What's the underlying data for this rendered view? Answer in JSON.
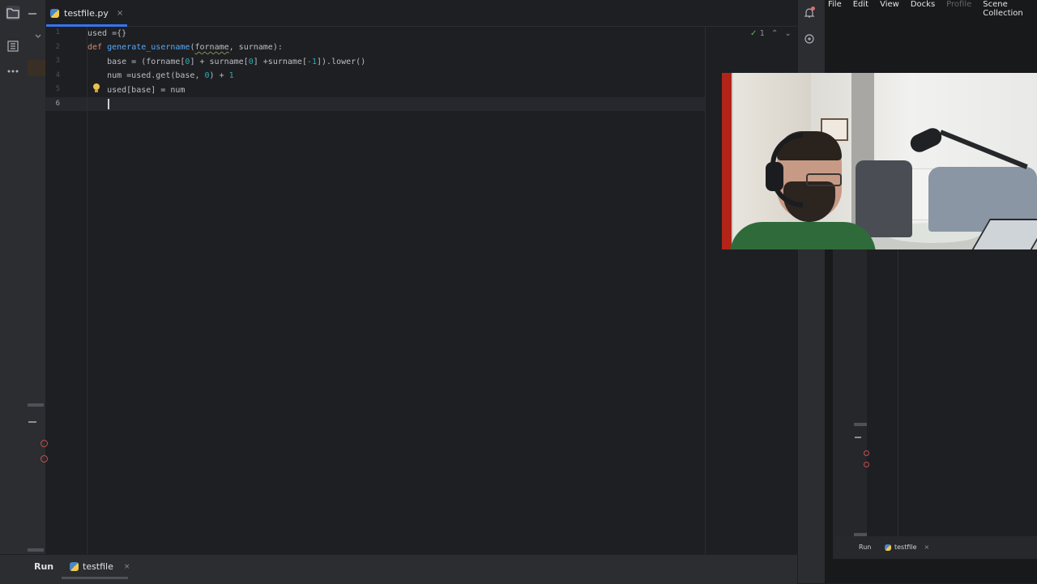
{
  "editor": {
    "tab": {
      "filename": "testfile.py",
      "close": "×"
    },
    "inspection": {
      "check": "✓",
      "count": "1",
      "up": "⌃",
      "down": "⌄"
    },
    "line_numbers": [
      "1",
      "2",
      "3",
      "4",
      "5",
      "6"
    ],
    "code": {
      "l1": {
        "text": "used ={}"
      },
      "l2": {
        "kw": "def",
        "fn": "generate_username",
        "open": "(",
        "param1": "forname",
        "rest": ", surname):"
      },
      "l3": {
        "a": "    base = (forname[",
        "n1": "0",
        "b": "] + surname[",
        "n2": "0",
        "c": "] +surname[",
        "n3": "-1",
        "d": "]).lower()"
      },
      "l4": {
        "a": "    num =used.get(base, ",
        "n1": "0",
        "b": ") + ",
        "n2": "1"
      },
      "l5": {
        "text": "    used[base] = num"
      }
    }
  },
  "bottom": {
    "run": "Run",
    "run_tab": "testfile",
    "run_close": "×"
  },
  "obs": {
    "menu": [
      "File",
      "Edit",
      "View",
      "Docks",
      "Profile",
      "Scene Collection"
    ],
    "preview_run": "Run",
    "preview_tab": "testfile",
    "preview_close": "×"
  },
  "icons": {
    "folder": "folder-icon",
    "structure": "structure-icon",
    "more": "more-icon",
    "notifications": "bell-icon",
    "ai": "ai-assistant-icon",
    "bulb": "lightbulb-icon",
    "python": "python-file-icon"
  },
  "colors": {
    "keyword": "#cf8e6d",
    "function": "#56a8f5",
    "number": "#2aacb8",
    "text": "#bcbec4",
    "accent": "#3574f0",
    "background": "#1e1f22"
  }
}
